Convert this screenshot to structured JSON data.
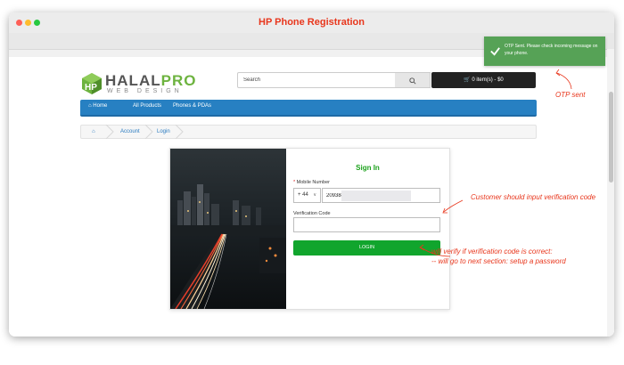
{
  "window": {
    "title": "HP Phone Registration"
  },
  "logo": {
    "main_a": "HALAL",
    "main_b": "PRO",
    "sub": "WEB DESIGN"
  },
  "search": {
    "placeholder": "Search",
    "value": "Search"
  },
  "cart": {
    "label": "0 item(s) - $0",
    "icon": "cart-icon"
  },
  "nav": {
    "items": [
      "Home",
      "All Products",
      "Phones & PDAs"
    ],
    "home_icon": "home-icon"
  },
  "breadcrumb": {
    "items": [
      "Account",
      "Login"
    ],
    "home_icon": "home-icon"
  },
  "login": {
    "title": "Sign In",
    "mobile_label": "Mobile Number",
    "required_mark": "*",
    "country_code": "+ 44",
    "phone_value": "209384",
    "code_label": "Verification Code",
    "code_value": "",
    "button": "LOGIN"
  },
  "toast": {
    "message": "OTP Sent. Please check incoming message on your phone."
  },
  "annotations": {
    "otp_sent": "OTP sent",
    "customer_input": "Customer should input verification code",
    "verify_line1": "will verify if verification code is correct:",
    "verify_line2": "-- will go to next section: setup a password"
  },
  "colors": {
    "accent": "#2780c2",
    "success": "#11a52d",
    "toast": "#56a256",
    "annotation": "#e8361c"
  }
}
